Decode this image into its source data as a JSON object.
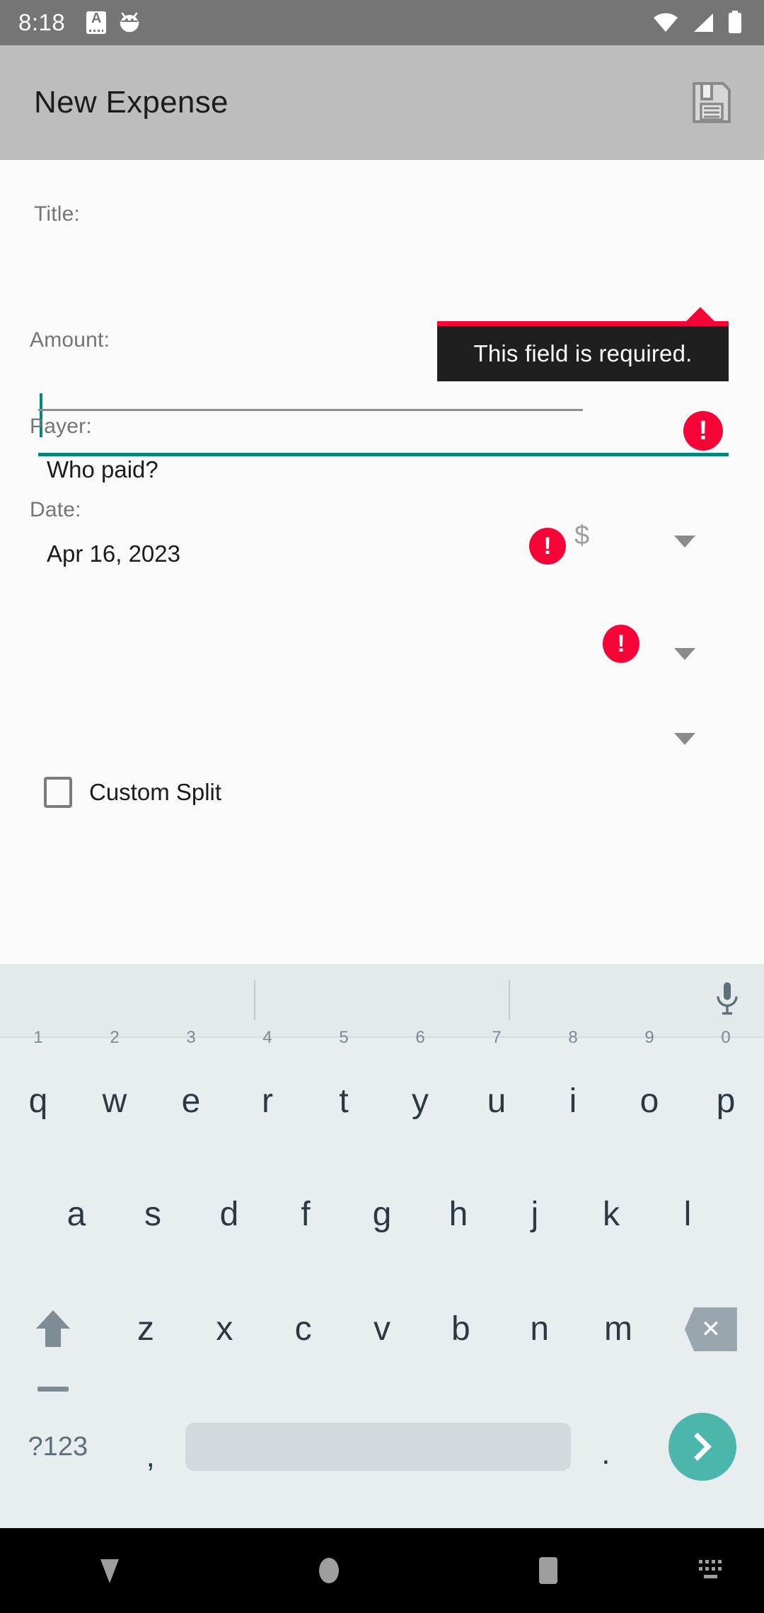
{
  "status_bar": {
    "time": "8:18",
    "left_icons": [
      "app-notification-icon",
      "android-notification-icon"
    ],
    "right_icons": [
      "wifi-icon",
      "cellular-signal-icon",
      "battery-icon"
    ],
    "background": "#757575"
  },
  "app_bar": {
    "title": "New Expense",
    "background": "#bdbdbd",
    "save_action": "save-icon"
  },
  "form": {
    "title_field": {
      "label": "Title:",
      "value": "",
      "focused": true,
      "error": true,
      "accent": "#00897b"
    },
    "amount_field": {
      "label": "Amount:",
      "value": "",
      "currency_symbol": "$",
      "error": true
    },
    "payer_field": {
      "label": "Payer:",
      "value": "Who paid?",
      "error": true
    },
    "date_field": {
      "label": "Date:",
      "value": "Apr 16, 2023",
      "error": false
    },
    "custom_split": {
      "label": "Custom Split",
      "checked": false
    },
    "tooltip": {
      "text": "This field is required.",
      "background": "#1f1f1f",
      "accent": "#f50537"
    },
    "error_color": "#f50537"
  },
  "keyboard": {
    "suggestions": [
      "",
      "",
      ""
    ],
    "mic": "microphone-icon",
    "row1": [
      {
        "key": "q",
        "hint": "1"
      },
      {
        "key": "w",
        "hint": "2"
      },
      {
        "key": "e",
        "hint": "3"
      },
      {
        "key": "r",
        "hint": "4"
      },
      {
        "key": "t",
        "hint": "5"
      },
      {
        "key": "y",
        "hint": "6"
      },
      {
        "key": "u",
        "hint": "7"
      },
      {
        "key": "i",
        "hint": "8"
      },
      {
        "key": "o",
        "hint": "9"
      },
      {
        "key": "p",
        "hint": "0"
      }
    ],
    "row2": [
      "a",
      "s",
      "d",
      "f",
      "g",
      "h",
      "j",
      "k",
      "l"
    ],
    "row3": [
      "z",
      "x",
      "c",
      "v",
      "b",
      "n",
      "m"
    ],
    "shift": "shift-icon",
    "backspace": "backspace-icon",
    "symbols_key": "?123",
    "comma_key": ",",
    "period_key": ".",
    "space_key": "",
    "enter_key": "enter-chevron-icon",
    "enter_color": "#4db6ac",
    "background": "#e8edf0"
  },
  "nav_bar": {
    "back": "back-collapse-icon",
    "home": "home-icon",
    "recents": "recents-icon",
    "keyboard_switch": "keyboard-switch-icon",
    "background": "#000000"
  }
}
